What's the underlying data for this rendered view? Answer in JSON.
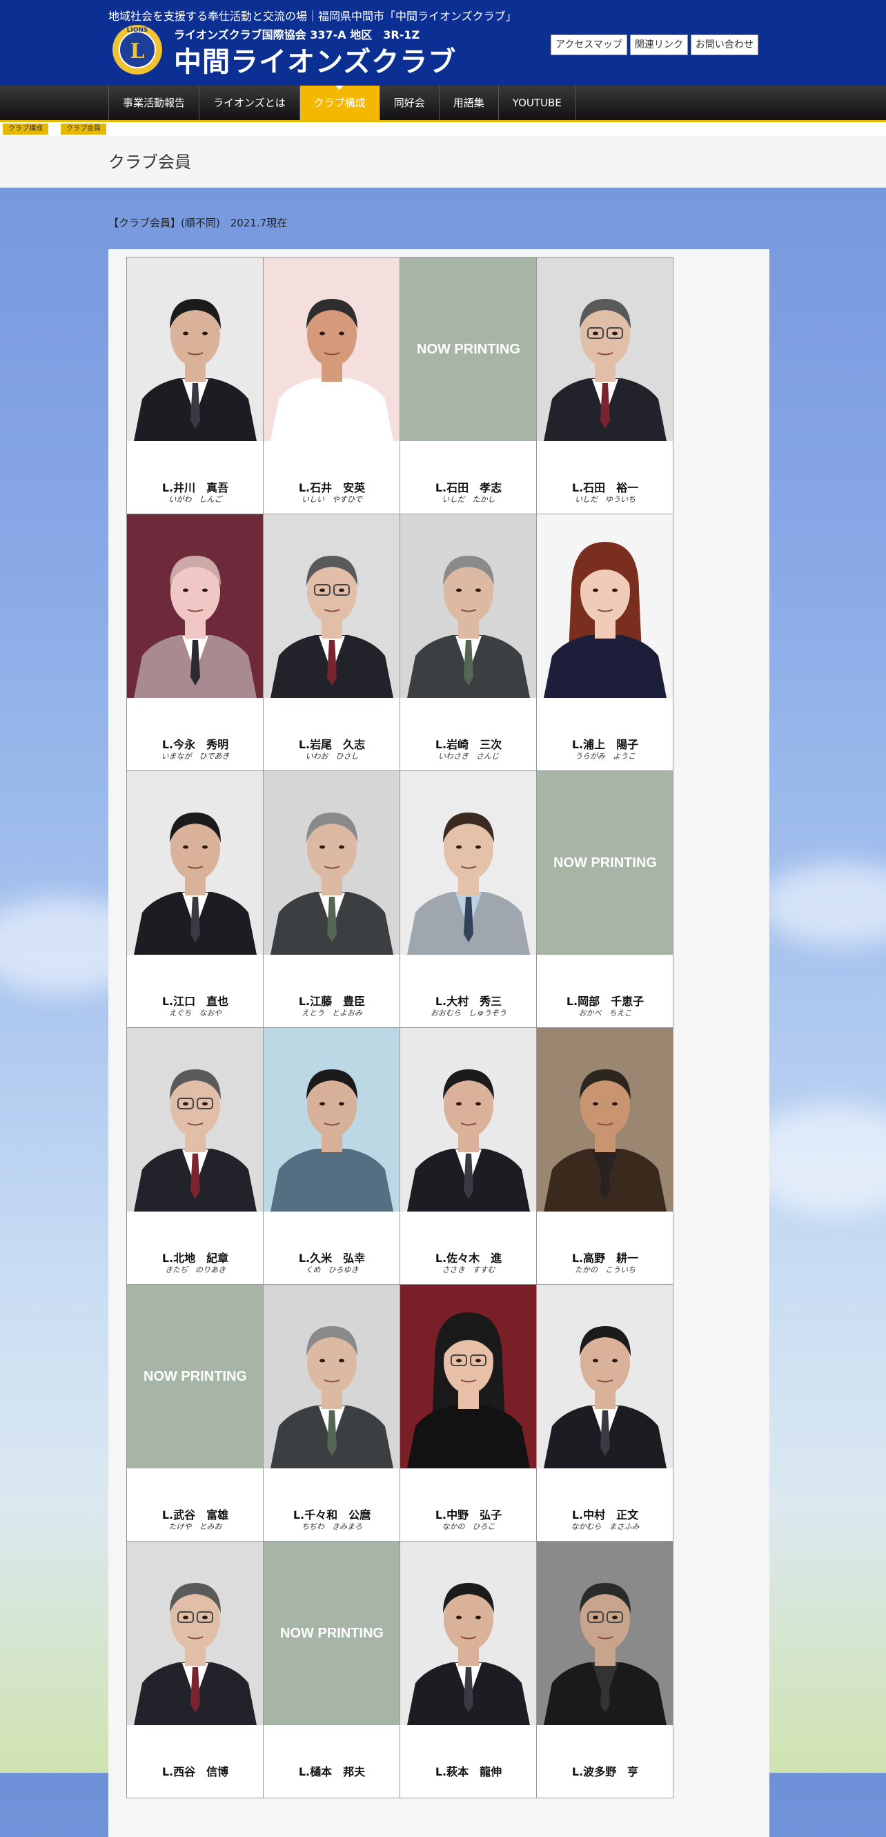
{
  "header": {
    "tagline": "地域社会を支援する奉仕活動と交流の場｜福岡県中間市「中間ライオンズクラブ」",
    "org": "ライオンズクラブ国際協会 337-A 地区　3R-1Z",
    "club_name": "中間ライオンズクラブ",
    "logo_text": "LIONS",
    "links": [
      "アクセスマップ",
      "関連リンク",
      "お問い合わせ"
    ]
  },
  "nav": {
    "items": [
      "事業活動報告",
      "ライオンズとは",
      "クラブ構成",
      "同好会",
      "用語集",
      "YOUTUBE"
    ],
    "active_index": 2
  },
  "breadcrumb": [
    "クラブ構成",
    "クラブ会員"
  ],
  "page": {
    "title": "クラブ会員",
    "intro": "【クラブ会員】(順不同)　2021.7現在"
  },
  "now_printing_label": "NOW PRINTING",
  "members": [
    {
      "name": "L.井川　真吾",
      "kana": "いがわ　しんご",
      "photo": "suit-dark"
    },
    {
      "name": "L.石井　安英",
      "kana": "いしい　やすひで",
      "photo": "shirt-white"
    },
    {
      "name": "L.石田　孝志",
      "kana": "いしだ　たかし",
      "photo": "now-printing"
    },
    {
      "name": "L.石田　裕一",
      "kana": "いしだ　ゆういち",
      "photo": "suit-glasses"
    },
    {
      "name": "L.今永　秀明",
      "kana": "いまなが　ひであき",
      "photo": "suit-pink"
    },
    {
      "name": "L.岩尾　久志",
      "kana": "いわお　ひさし",
      "photo": "suit-glasses"
    },
    {
      "name": "L.岩崎　三次",
      "kana": "いわさき　さんじ",
      "photo": "suit-gray"
    },
    {
      "name": "L.浦上　陽子",
      "kana": "うらがみ　ようこ",
      "photo": "woman"
    },
    {
      "name": "L.江口　直也",
      "kana": "えぐち　なおや",
      "photo": "suit-dark"
    },
    {
      "name": "L.江藤　豊臣",
      "kana": "えとう　とよおみ",
      "photo": "suit-gray"
    },
    {
      "name": "L.大村　秀三",
      "kana": "おおむら　しゅうぞう",
      "photo": "suit-light"
    },
    {
      "name": "L.岡部　千恵子",
      "kana": "おかべ　ちえこ",
      "photo": "now-printing"
    },
    {
      "name": "L.北地　紀章",
      "kana": "きたぢ　のりあき",
      "photo": "suit-glasses"
    },
    {
      "name": "L.久米　弘幸",
      "kana": "くめ　ひろゆき",
      "photo": "shirt-blue"
    },
    {
      "name": "L.佐々木　進",
      "kana": "ささき　すすむ",
      "photo": "suit-dark"
    },
    {
      "name": "L.高野　耕一",
      "kana": "たかの　こういち",
      "photo": "jacket-brown"
    },
    {
      "name": "L.武谷　富雄",
      "kana": "たけや　とみお",
      "photo": "now-printing"
    },
    {
      "name": "L.千々和　公麿",
      "kana": "ちぢわ　きみまろ",
      "photo": "suit-gray"
    },
    {
      "name": "L.中野　弘子",
      "kana": "なかの　ひろこ",
      "photo": "woman-red"
    },
    {
      "name": "L.中村　正文",
      "kana": "なかむら　まさふみ",
      "photo": "suit-dark"
    },
    {
      "name": "L.西谷　信博",
      "kana": "",
      "photo": "suit-glasses"
    },
    {
      "name": "L.樋本　邦夫",
      "kana": "",
      "photo": "now-printing"
    },
    {
      "name": "L.萩本　龍伸",
      "kana": "",
      "photo": "suit-dark"
    },
    {
      "name": "L.波多野　亨",
      "kana": "",
      "photo": "jacket-black"
    }
  ]
}
